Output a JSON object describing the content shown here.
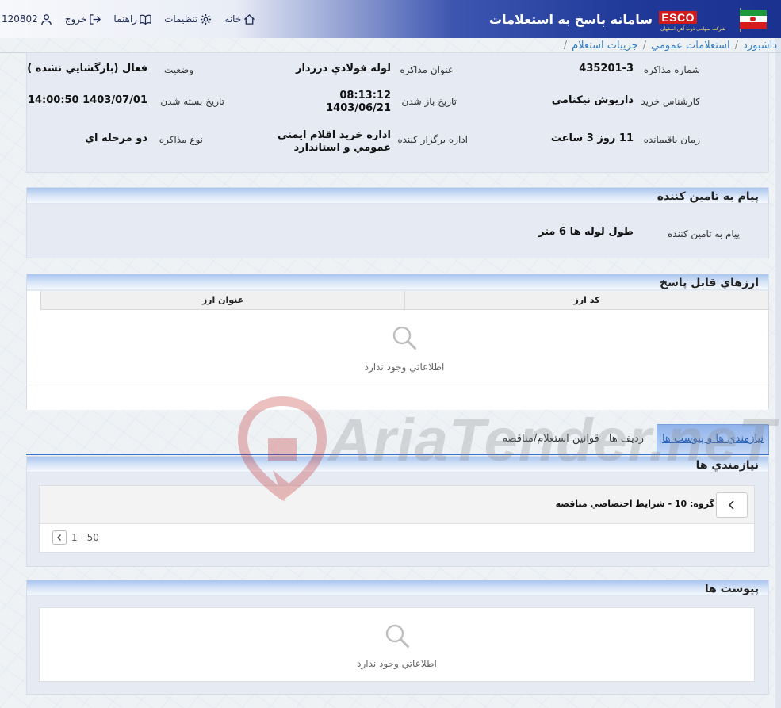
{
  "header": {
    "title": "سامانه پاسخ به استعلامات",
    "logo_text": "ESCO",
    "logo_subtitle": "شرکت سهامی ذوب آهن اصفهان",
    "nav": {
      "home": "خانه",
      "settings": "تنظیمات",
      "help": "راهنما",
      "logout": "خروج",
      "user_id": "120802"
    }
  },
  "breadcrumb": {
    "items": [
      "ه داشبورد",
      "استعلامات عمومي",
      "جزييات استعلام"
    ],
    "separator": "/"
  },
  "details": {
    "rows": [
      [
        {
          "label": "شماره مذاکره",
          "value": "435201-3"
        },
        {
          "label": "عنوان مذاكره",
          "value": "لوله فولادي درزدار"
        },
        {
          "label": "وضعيت",
          "value": "فعال (بازگشايي نشده )"
        }
      ],
      [
        {
          "label": "كارشناس خريد",
          "value": "داريوش نيكنامي"
        },
        {
          "label": "تاريخ باز شدن",
          "value_line1": "08:13:12",
          "value_line2": "1403/06/21"
        },
        {
          "label": "تاريخ بسته شدن",
          "value": "1403/07/01 14:00:50"
        }
      ],
      [
        {
          "label": "زمان باقيمانده",
          "value": "11 روز 3 ساعت"
        },
        {
          "label": "اداره برگزار كننده",
          "value_line1": "اداره خريد اقلام ايمني",
          "value_line2": "عمومي و استاندارد"
        },
        {
          "label": "نوع مذاكره",
          "value": "دو مرحله اي"
        }
      ]
    ]
  },
  "message": {
    "title": "پيام به تامين كننده",
    "label": "پيام به تامين كننده",
    "value": "طول لوله ها 6 متر"
  },
  "currencies": {
    "title": "ارزهاي قابل پاسخ",
    "columns": [
      "كد ارز",
      "عنوان ارز"
    ],
    "empty_text": "اطلاعاتي وجود ندارد"
  },
  "tabs": [
    {
      "label": "نيازمندي ها و پيوست ها",
      "active": true
    },
    {
      "label": "رديف ها",
      "active": false
    },
    {
      "label": "قوانين استعلام/مناقصه",
      "active": false
    }
  ],
  "requirements": {
    "title": "نيازمندي ها",
    "group_label": "گروه: 10 - شرايط اختصاصي مناقصه",
    "pager_text": "1 - 50"
  },
  "attachments": {
    "title": "پيوست ها",
    "empty_text": "اطلاعاتي وجود ندارد"
  },
  "watermark": {
    "text": "AriaTender.neT"
  },
  "colors": {
    "header_dark": "#1b3190",
    "panel_bg": "#e6ebf3",
    "link": "#3a7fc2",
    "tab_active": "#2a62b8",
    "logo_red": "#d11a1a"
  }
}
